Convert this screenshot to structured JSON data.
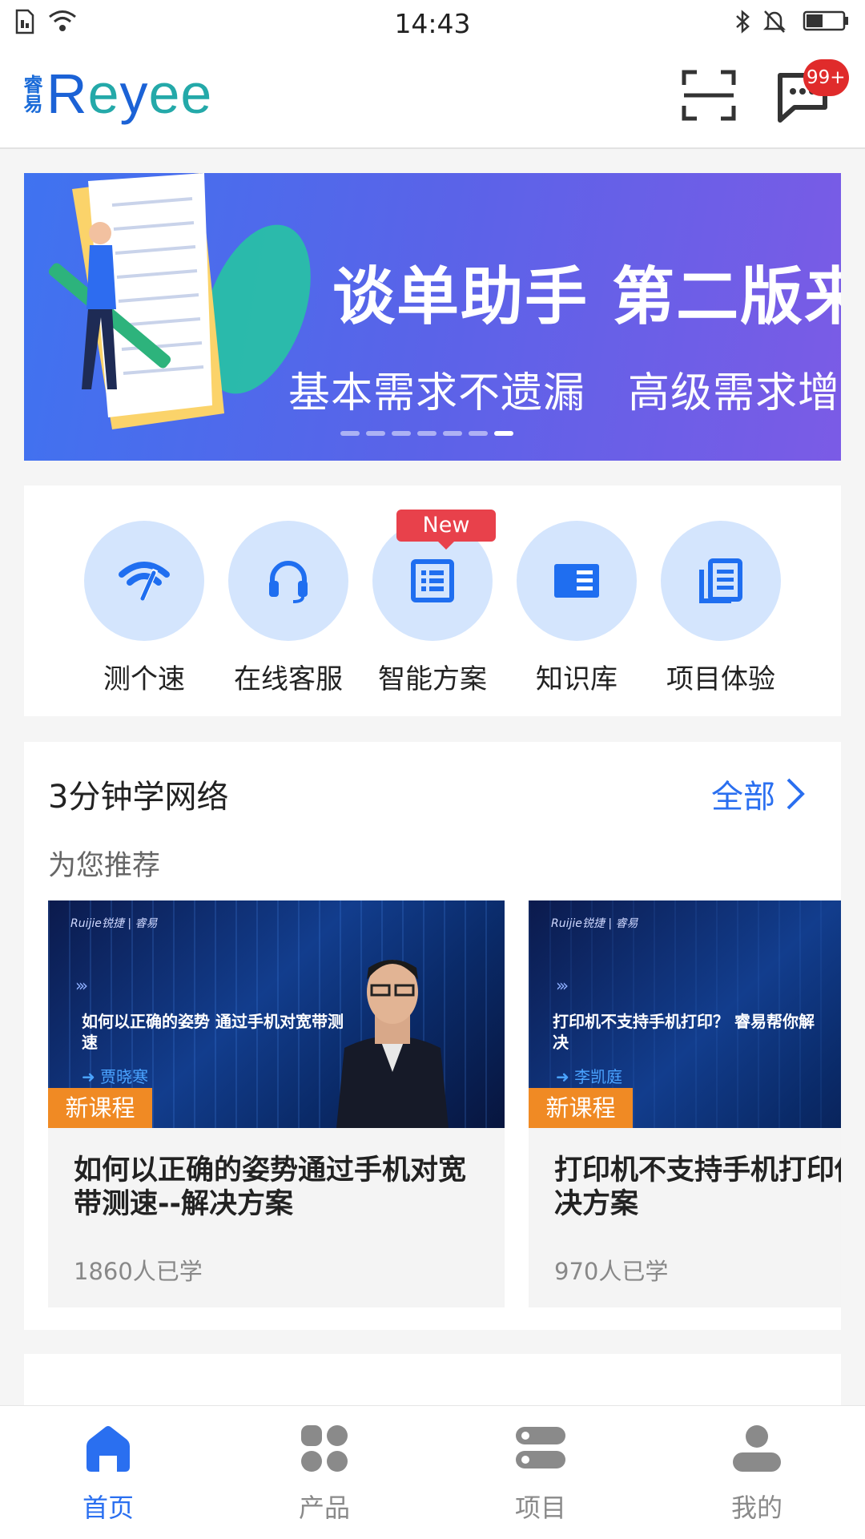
{
  "status_bar": {
    "time": "14:43"
  },
  "header": {
    "logo_text": "Reyee",
    "logo_mark": "睿易",
    "message_badge": "99+"
  },
  "banner": {
    "title": "谈单助手 第二版来啦",
    "subtitle": "基本需求不遗漏　高级需求增利润",
    "dot_count": 7,
    "active_dot": 6
  },
  "shortcuts": [
    {
      "label": "测个速",
      "icon": "speed-test-icon"
    },
    {
      "label": "在线客服",
      "icon": "headset-icon"
    },
    {
      "label": "智能方案",
      "icon": "document-list-icon",
      "tag": "New"
    },
    {
      "label": "知识库",
      "icon": "book-icon"
    },
    {
      "label": "项目体验",
      "icon": "project-doc-icon"
    }
  ],
  "learn": {
    "title": "3分钟学网络",
    "see_all": "全部",
    "recommend_label": "为您推荐",
    "courses": [
      {
        "tag": "新课程",
        "thumb_text": "如何以正确的姿势 通过手机对宽带测速",
        "presenter": "贾晓寒",
        "title": "如何以正确的姿势通过手机对宽带测速--解决方案",
        "count": "1860人已学"
      },
      {
        "tag": "新课程",
        "thumb_text": "打印机不支持手机打印？ 睿易帮你解决",
        "presenter": "李凯庭",
        "title": "打印机不支持手机打印你解决--解决方案",
        "count": "970人已学"
      }
    ]
  },
  "tab_bar": [
    {
      "label": "首页",
      "icon": "home-icon",
      "active": true
    },
    {
      "label": "产品",
      "icon": "grid-icon",
      "active": false
    },
    {
      "label": "项目",
      "icon": "list-icon",
      "active": false
    },
    {
      "label": "我的",
      "icon": "user-icon",
      "active": false
    }
  ],
  "colors": {
    "accent": "#2a6ff0",
    "badge": "#e02b2b",
    "course_tag": "#f08a24",
    "new_tag": "#e8414b"
  }
}
